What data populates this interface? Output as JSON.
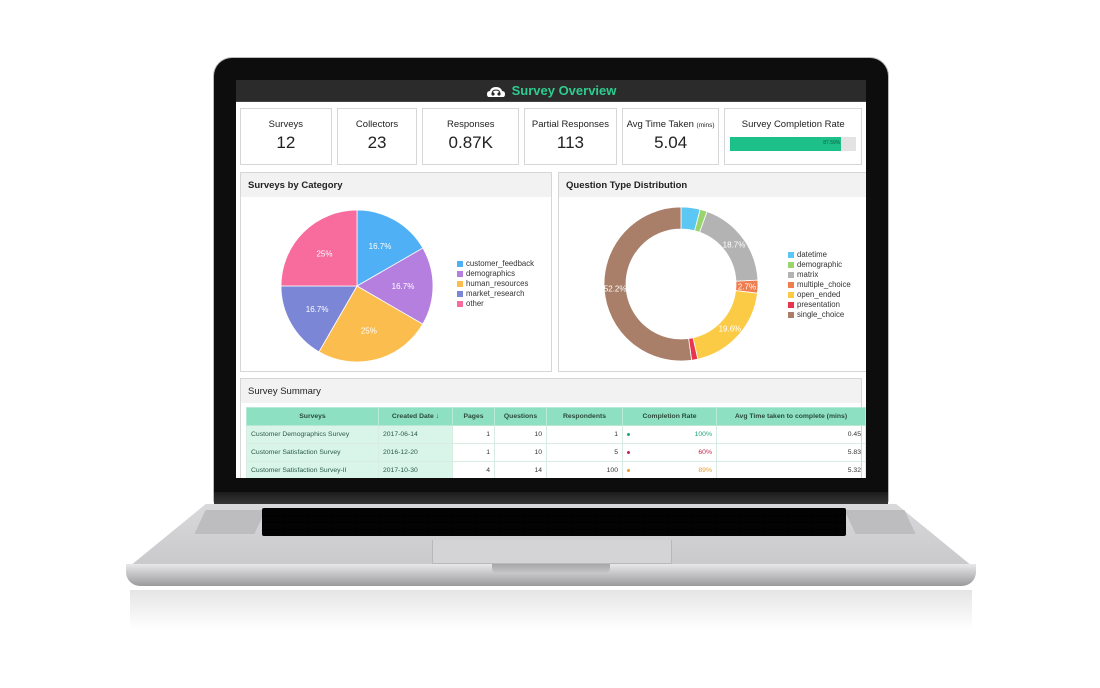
{
  "header": {
    "title": "Survey Overview",
    "logo_icon": "cloud-headset-icon"
  },
  "kpis": [
    {
      "label": "Surveys",
      "value": "12"
    },
    {
      "label": "Collectors",
      "value": "23"
    },
    {
      "label": "Responses",
      "value": "0.87K"
    },
    {
      "label": "Partial Responses",
      "value": "113"
    },
    {
      "label": "Avg Time Taken",
      "label_suffix": "(mins)",
      "value": "5.04"
    },
    {
      "label": "Survey Completion Rate",
      "progress_percent": 87.59,
      "progress_text": "87.59%"
    }
  ],
  "colors": {
    "accent": "#2ecc8e",
    "progress": "#1ec08a",
    "table_header": "#8ee0c2"
  },
  "chart_data": [
    {
      "type": "pie",
      "title": "Surveys by Category",
      "categories": [
        "customer_feedback",
        "demographics",
        "human_resources",
        "market_research",
        "other"
      ],
      "values": [
        16.7,
        16.7,
        25,
        16.7,
        25
      ],
      "labels": [
        "16.7%",
        "16.7%",
        "25%",
        "16.7%",
        "25%"
      ],
      "colors": [
        "#4fb0f5",
        "#b57fe0",
        "#fbbd4e",
        "#7b86d6",
        "#f76b9d"
      ],
      "legend": "right"
    },
    {
      "type": "pie",
      "donut": true,
      "title": "Question Type Distribution",
      "categories": [
        "datetime",
        "demographic",
        "matrix",
        "multiple_choice",
        "open_ended",
        "presentation",
        "single_choice"
      ],
      "values": [
        4.0,
        1.5,
        18.7,
        2.7,
        19.6,
        1.3,
        52.2
      ],
      "labels": [
        "",
        "",
        "18.7%",
        "2.7%",
        "19.6%",
        "",
        "52.2%"
      ],
      "colors": [
        "#5bc7f2",
        "#9ad46c",
        "#b3b3b3",
        "#f07d4e",
        "#fbcb45",
        "#e8354f",
        "#a97f6a"
      ],
      "legend": "right"
    }
  ],
  "summary": {
    "title": "Survey Summary",
    "columns": [
      "Surveys",
      "Created Date",
      "Pages",
      "Questions",
      "Respondents",
      "Completion Rate",
      "Avg Time taken to complete (mins)"
    ],
    "sort_icon": "arrow-down-icon",
    "rows": [
      {
        "survey": "Customer Demographics Survey",
        "created": "2017-06-14",
        "pages": "1",
        "questions": "10",
        "respondents": "1",
        "rate": "100%",
        "rate_color": "#1ea67a",
        "avg": "0.45"
      },
      {
        "survey": "Customer Satisfaction Survey",
        "created": "2016-12-20",
        "pages": "1",
        "questions": "10",
        "respondents": "5",
        "rate": "60%",
        "rate_color": "#c2264d",
        "avg": "5.83"
      },
      {
        "survey": "Customer Satisfaction Survey-II",
        "created": "2017-10-30",
        "pages": "4",
        "questions": "14",
        "respondents": "100",
        "rate": "89%",
        "rate_color": "#e69a2e",
        "avg": "5.32"
      }
    ]
  }
}
